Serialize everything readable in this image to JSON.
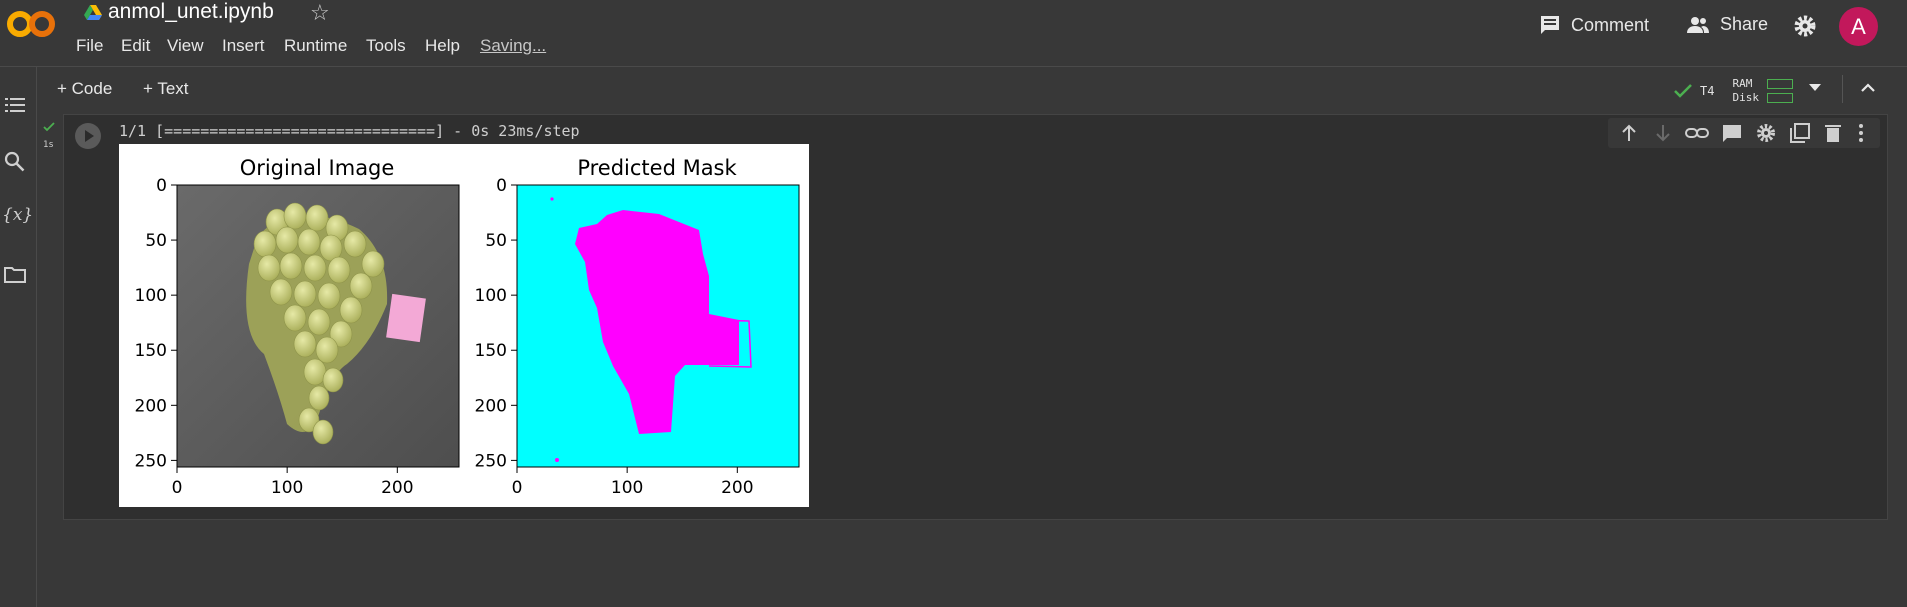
{
  "app": {
    "filename": "anmol_unet.ipynb",
    "star_icon": "star-icon",
    "status": "Saving...",
    "menu": [
      "File",
      "Edit",
      "View",
      "Insert",
      "Runtime",
      "Tools",
      "Help"
    ]
  },
  "header": {
    "comment_label": "Comment",
    "share_label": "Share",
    "avatar_letter": "A",
    "avatar_color": "#c2185b"
  },
  "toolbar": {
    "add_code": "Code",
    "add_text": "Text",
    "runtime_gpu": "T4",
    "ram_label": "RAM",
    "disk_label": "Disk"
  },
  "cell": {
    "exec_time": "1s",
    "output_text": "1/1 [==============================] - 0s 23ms/step",
    "accent": "#4caf50"
  },
  "chart_data": [
    {
      "type": "image",
      "title": "Original Image",
      "xticks": [
        0,
        100,
        200
      ],
      "yticks": [
        0,
        50,
        100,
        150,
        200,
        250
      ],
      "xlim": [
        0,
        256
      ],
      "ylim": [
        256,
        0
      ]
    },
    {
      "type": "image",
      "title": "Predicted Mask",
      "xticks": [
        0,
        100,
        200
      ],
      "yticks": [
        0,
        50,
        100,
        150,
        200,
        250
      ],
      "xlim": [
        0,
        256
      ],
      "ylim": [
        256,
        0
      ],
      "colors": {
        "background": "#00ffff",
        "mask": "#ff00ff"
      }
    }
  ]
}
